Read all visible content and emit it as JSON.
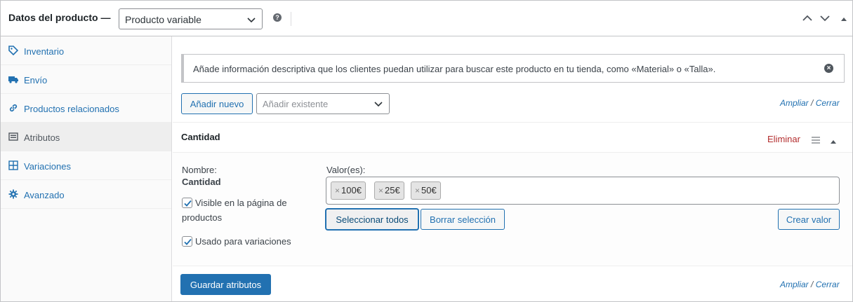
{
  "header": {
    "title": "Datos del producto —",
    "product_type": "Producto variable",
    "help_glyph": "?"
  },
  "sidebar": {
    "items": [
      {
        "label": "Inventario",
        "icon": "tag-icon"
      },
      {
        "label": "Envío",
        "icon": "truck-icon"
      },
      {
        "label": "Productos relacionados",
        "icon": "link-icon"
      },
      {
        "label": "Atributos",
        "icon": "list-icon"
      },
      {
        "label": "Variaciones",
        "icon": "grid-icon"
      },
      {
        "label": "Avanzado",
        "icon": "gear-icon"
      }
    ],
    "active_index": 3
  },
  "notice": {
    "text": "Añade información descriptiva que los clientes puedan utilizar para buscar este producto en tu tienda, como «Material» o «Talla».",
    "close_glyph": "×"
  },
  "toolbar": {
    "add_new": "Añadir nuevo",
    "add_existing_placeholder": "Añadir existente",
    "expand": "Ampliar",
    "slash": "/",
    "close": "Cerrar"
  },
  "attribute": {
    "name": "Cantidad",
    "remove": "Eliminar",
    "name_label": "Nombre:",
    "name_value": "Cantidad",
    "visible_label_line1": "Visible en la página de",
    "visible_label_line2": "productos",
    "visible_checked": true,
    "variations_label": "Usado para variaciones",
    "variations_checked": true,
    "values_label": "Valor(es):",
    "values": [
      "100€",
      "25€",
      "50€"
    ],
    "chip_remove_glyph": "×",
    "select_all": "Seleccionar todos",
    "clear_selection": "Borrar selección",
    "create_value": "Crear valor"
  },
  "footer": {
    "save": "Guardar atributos",
    "expand": "Ampliar",
    "slash": "/",
    "close": "Cerrar"
  },
  "colors": {
    "accent": "#2271b1",
    "danger": "#b32d2e",
    "text": "#1d2327"
  }
}
